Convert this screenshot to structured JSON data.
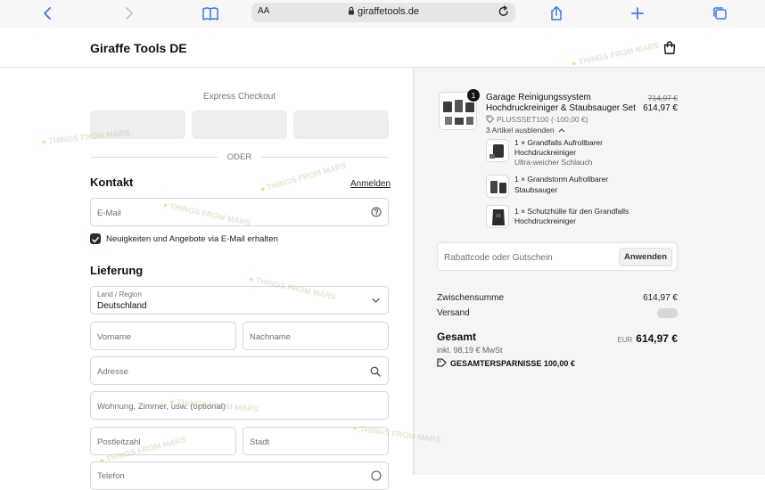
{
  "browser": {
    "url": "giraffetools.de",
    "reader_label": "AA"
  },
  "header": {
    "shop_name": "Giraffe Tools DE"
  },
  "checkout": {
    "express_label": "Express Checkout",
    "or_label": "ODER",
    "contact": {
      "title": "Kontakt",
      "login_link": "Anmelden",
      "email_placeholder": "E-Mail",
      "newsletter_label": "Neuigkeiten und Angebote via E-Mail erhalten",
      "newsletter_checked": true
    },
    "delivery": {
      "title": "Lieferung",
      "country_label": "Land / Region",
      "country_value": "Deutschland",
      "first_name_placeholder": "Vorname",
      "last_name_placeholder": "Nachname",
      "address_placeholder": "Adresse",
      "apartment_placeholder": "Wohnung, Zimmer, usw. (optional)",
      "zip_placeholder": "Postleitzahl",
      "city_placeholder": "Stadt",
      "phone_placeholder": "Telefon"
    }
  },
  "summary": {
    "product": {
      "quantity_badge": "1",
      "name_line1": "Garage Reinigungssystem",
      "name_line2": "Hochdruckreiniger & Staubsauger Set",
      "discount_code": "PLUSSSET100 (-100,00 €)",
      "original_price": "714,97 €",
      "price": "614,97 €",
      "toggle_items": "3 Artikel ausblenden"
    },
    "bundle_items": [
      {
        "line1": "1 × Grandfalls Aufrollbarer",
        "line2": "Hochdruckreiniger",
        "line3": "Ultra-weicher Schlauch"
      },
      {
        "line1": "1 × Grandstorm Aufrollbarer",
        "line2": "Staubsauger",
        "line3": ""
      },
      {
        "line1": "1 × Schutzhülle für den Grandfalls",
        "line2": "Hochdruckreiniger",
        "line3": ""
      }
    ],
    "coupon_placeholder": "Rabattcode oder Gutschein",
    "apply_button": "Anwenden",
    "subtotal_label": "Zwischensumme",
    "subtotal_value": "614,97 €",
    "shipping_label": "Versand",
    "total_label": "Gesamt",
    "currency": "EUR",
    "total_value": "614,97 €",
    "tax_note": "inkl. 98,19 € MwSt",
    "savings_label": "GESAMTERSPARNISSE",
    "savings_value": "100,00 €"
  },
  "watermark": "THINGS FROM MARS",
  "colors": {
    "summary_bg": "#f5f5f5",
    "border": "#d7d7d7",
    "accent_ios": "#3478f6",
    "text": "#1a1a1a"
  }
}
